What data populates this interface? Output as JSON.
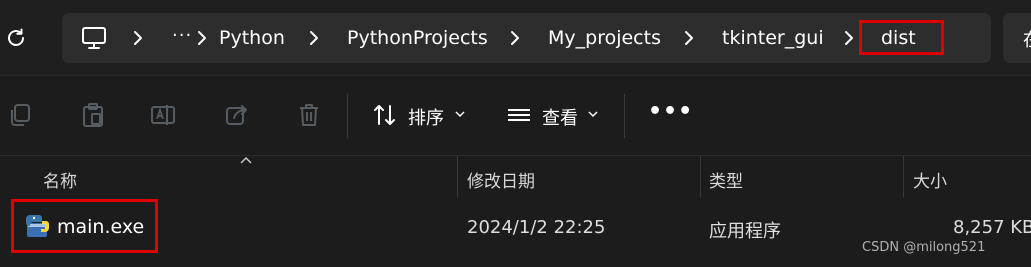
{
  "address_bar": {
    "breadcrumbs": [
      "Python",
      "PythonProjects",
      "My_projects",
      "tkinter_gui",
      "dist"
    ],
    "overflow": "···",
    "side_partial": "在"
  },
  "toolbar": {
    "sort_label": "排序",
    "view_label": "查看",
    "more_label": "•••"
  },
  "columns": {
    "name": "名称",
    "modified": "修改日期",
    "type": "类型",
    "size": "大小"
  },
  "rows": [
    {
      "name": "main.exe",
      "modified": "2024/1/2 22:25",
      "type": "应用程序",
      "size": "8,257 KB"
    }
  ],
  "watermark": "CSDN @milong521",
  "colors": {
    "highlight": "#e00000",
    "background": "#1c1c1c",
    "address_box": "#2d2d2d"
  },
  "icons": [
    "refresh-icon",
    "pc-icon",
    "chevron-right-icon",
    "copy-icon",
    "paste-icon",
    "rename-icon",
    "share-icon",
    "delete-icon",
    "sort-icon",
    "view-icon",
    "python-exe-icon"
  ]
}
